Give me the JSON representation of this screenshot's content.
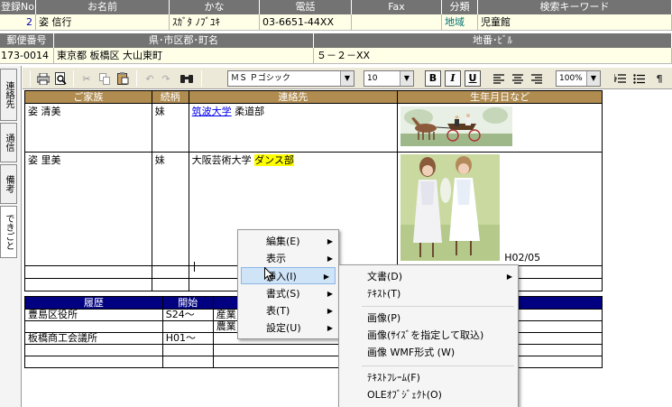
{
  "record_header": {
    "columns": [
      "登録No",
      "お名前",
      "かな",
      "電話",
      "Fax",
      "分類",
      "検索キーワード"
    ],
    "values": {
      "no": "2",
      "name": "姿 信行",
      "kana": "ｽｶﾞﾀ ﾉﾌﾞﾕｷ",
      "phone": "03-6651-44XX",
      "fax": "",
      "category": "地域",
      "keyword": "児童館"
    }
  },
  "address": {
    "labels": [
      "郵便番号",
      "県･市区郡･町名",
      "地番･ﾋﾞﾙ"
    ],
    "zip": "173-0014",
    "city": "東京都 板橋区 大山東町",
    "street": "５－２－XX"
  },
  "vertical_tabs": [
    "連絡先",
    "通信",
    "備考",
    "できごと"
  ],
  "toolbar": {
    "font_name": "ＭＳ Ｐゴシック",
    "font_size": "10",
    "bold": "B",
    "italic": "I",
    "underline": "U",
    "zoom": "100%",
    "paragraph": "¶"
  },
  "family_table": {
    "headers": [
      "ご家族",
      "続柄",
      "連絡先",
      "生年月日など"
    ],
    "rows": [
      {
        "name": "姿 清美",
        "relation": "妹",
        "contact_link": "筑波大学",
        "contact_rest": "柔道部",
        "note": ""
      },
      {
        "name": "姿 里美",
        "relation": "妹",
        "contact_prefix": "大阪芸術大学",
        "contact_highlight": "ダンス部",
        "note": "H02/05"
      }
    ]
  },
  "history_table": {
    "headers": [
      "履歴",
      "開始"
    ],
    "rows": [
      {
        "org": "豊島区役所",
        "start": "S24～",
        "extra": "産業",
        "extra2": "農業"
      },
      {
        "org": "板橋商工会議所",
        "start": "H01～",
        "extra": "",
        "extra2": ""
      }
    ]
  },
  "context_menu": {
    "items": [
      "編集(E)",
      "表示",
      "挿入(I)",
      "書式(S)",
      "表(T)",
      "設定(U)"
    ]
  },
  "insert_submenu": {
    "items": [
      "文書(D)",
      "ﾃｷｽﾄ(T)",
      "画像(P)",
      "画像(ｻｲｽﾞを指定して取込)",
      "画像 WMF形式 (W)",
      "ﾃｷｽﾄﾌﾚｰﾑ(F)",
      "OLEｵﾌﾞｼﾞｪｸﾄ(O)"
    ]
  },
  "colors": {
    "header_gray": "#737373",
    "family_header": "#b08c50",
    "history_header": "#000080",
    "link": "#0000ee",
    "highlight": "#ffff00",
    "category": "#007070"
  }
}
